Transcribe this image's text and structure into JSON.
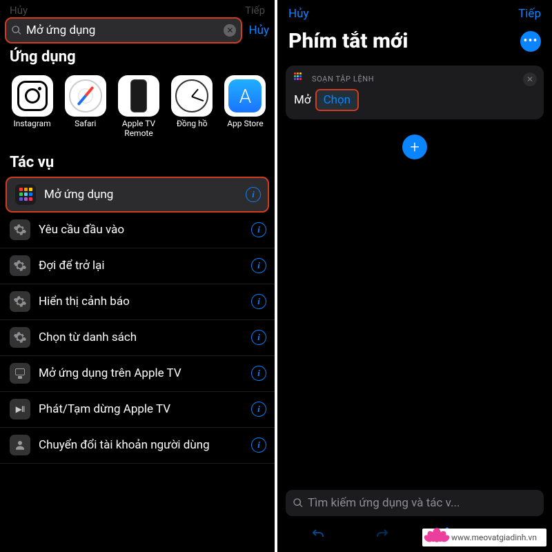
{
  "left": {
    "header_dim": {
      "left": "Hủy",
      "right": "Tiếp"
    },
    "search": {
      "value": "Mở ứng dụng",
      "cancel": "Hủy"
    },
    "section_apps": "Ứng dụng",
    "apps": [
      {
        "name": "Instagram",
        "icon": "instagram"
      },
      {
        "name": "Safari",
        "icon": "safari"
      },
      {
        "name": "Apple TV Remote",
        "icon": "atv-remote"
      },
      {
        "name": "Đồng hồ",
        "icon": "clock"
      },
      {
        "name": "App Store",
        "icon": "appstore"
      }
    ],
    "section_actions": "Tác vụ",
    "actions": [
      {
        "label": "Mở ứng dụng",
        "icon": "grid",
        "highlight": true
      },
      {
        "label": "Yêu cầu đầu vào",
        "icon": "gear"
      },
      {
        "label": "Đợi để trở lại",
        "icon": "gear"
      },
      {
        "label": "Hiển thị cảnh báo",
        "icon": "gear"
      },
      {
        "label": "Chọn từ danh sách",
        "icon": "gear"
      },
      {
        "label": "Mở ứng dụng trên Apple TV",
        "icon": "tv"
      },
      {
        "label": "Phát/Tạm dừng Apple TV",
        "icon": "playpause"
      },
      {
        "label": "Chuyển đổi tài khoản người dùng",
        "icon": "user"
      }
    ]
  },
  "right": {
    "header": {
      "cancel": "Hủy",
      "next": "Tiếp"
    },
    "title": "Phím tắt mới",
    "card": {
      "category": "SOẠN TẬP LỆNH",
      "static": "Mở",
      "choose": "Chọn"
    },
    "search_placeholder": "Tìm kiếm ứng dụng và tác v..."
  },
  "watermark": "www.meovatgiadinh.vn"
}
